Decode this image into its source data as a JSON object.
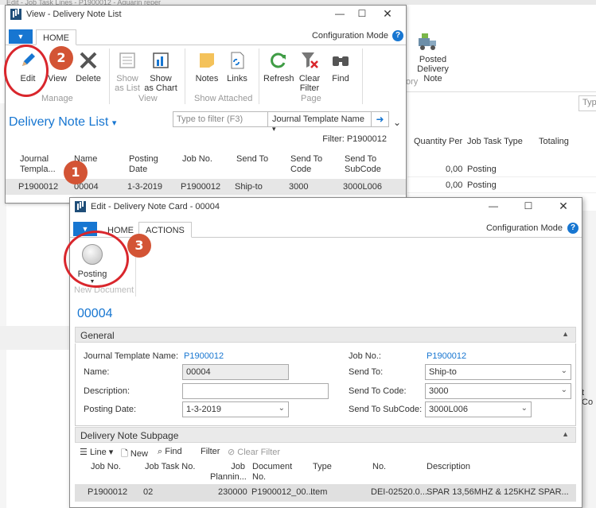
{
  "background": {
    "top_text": "Edit - Job Task Lines - P1900012 - Aquarin reper",
    "posted_delivery_note": "Posted Delivery Note",
    "ory_label": "ory",
    "filter_placeholder": "Typ",
    "columns": [
      "Quantity Per",
      "Job Task Type",
      "Totaling"
    ],
    "rows": [
      {
        "qty": "0,00",
        "type": "Posting"
      },
      {
        "qty": "0,00",
        "type": "Posting"
      }
    ],
    "right_fragment": "t Co"
  },
  "view_window": {
    "title": "View - Delivery Note List",
    "menu_label": "▼",
    "tab_home": "HOME",
    "config_mode": "Configuration Mode",
    "ribbon": {
      "edit": "Edit",
      "view": "View",
      "delete": "Delete",
      "show_as_list": "Show as List",
      "show_as_chart": "Show as Chart",
      "notes": "Notes",
      "links": "Links",
      "refresh": "Refresh",
      "clear_filter": "Clear Filter",
      "find": "Find",
      "group_manage": "Manage",
      "group_view": "View",
      "group_show_attached": "Show Attached",
      "group_page": "Page"
    },
    "list_title": "Delivery Note List",
    "filter_placeholder": "Type to filter (F3)",
    "filter_field": "Journal Template Name",
    "filter_status": "Filter: P1900012",
    "columns": [
      "Journal Templa...",
      "Name",
      "Posting Date",
      "Job No.",
      "Send To",
      "Send To Code",
      "Send To SubCode"
    ],
    "row": {
      "journal_template": "P1900012",
      "name": "00004",
      "posting_date": "1-3-2019",
      "job_no": "P1900012",
      "send_to": "Ship-to",
      "send_to_code": "3000",
      "send_to_subcode": "3000L006"
    }
  },
  "edit_window": {
    "title": "Edit - Delivery Note Card - 00004",
    "menu_label": "▼",
    "tab_home": "HOME",
    "tab_actions": "ACTIONS",
    "config_mode": "Configuration Mode",
    "posting_label": "Posting",
    "group_label": "New Document",
    "number": "00004",
    "general_header": "General",
    "fields": {
      "journal_template_name_label": "Journal Template Name:",
      "journal_template_name_value": "P1900012",
      "name_label": "Name:",
      "name_value": "00004",
      "description_label": "Description:",
      "description_value": "",
      "posting_date_label": "Posting Date:",
      "posting_date_value": "1-3-2019",
      "job_no_label": "Job No.:",
      "job_no_value": "P1900012",
      "send_to_label": "Send To:",
      "send_to_value": "Ship-to",
      "send_to_code_label": "Send To Code:",
      "send_to_code_value": "3000",
      "send_to_subcode_label": "Send To SubCode:",
      "send_to_subcode_value": "3000L006"
    },
    "subpage_header": "Delivery Note Subpage",
    "subpage_toolbar": {
      "line": "Line",
      "new": "New",
      "find": "Find",
      "filter": "Filter",
      "clear_filter": "Clear Filter"
    },
    "subpage_columns": [
      "Job No.",
      "Job Task No.",
      "Job Plannin...",
      "Document No.",
      "Type",
      "No.",
      "Description"
    ],
    "subpage_row": {
      "job_no": "P1900012",
      "job_task_no": "02",
      "job_planning": "230000",
      "document_no": "P1900012_00...",
      "type": "Item",
      "no": "DEI-02520.0...",
      "description": "SPAR 13,56MHZ & 125KHZ SPAR..."
    }
  },
  "annotations": {
    "badge1": "1",
    "badge2": "2",
    "badge3": "3"
  },
  "colors": {
    "accent": "#1776d1",
    "annotation_red": "#d9262c",
    "badge_orange": "#d35435"
  }
}
